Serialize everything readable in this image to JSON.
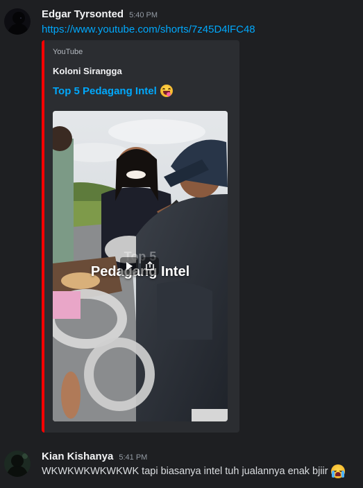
{
  "colors": {
    "background": "#1e1f22",
    "embed_background": "#2b2d31",
    "embed_border": "#ff0000",
    "link": "#00a8fc",
    "username": "#f2f3f5",
    "timestamp": "#949ba4"
  },
  "messages": [
    {
      "author": "Edgar Tyrsonted",
      "time": "5:40 PM",
      "link": "https://www.youtube.com/shorts/7z45D4lFC48",
      "embed": {
        "provider": "YouTube",
        "author": "Koloni Sirangga",
        "title": "Top 5 Pedagang Intel",
        "title_emoji": "laughing-tongue-emoji",
        "thumbnail_overlay_line1": "Top 5",
        "thumbnail_overlay_line2": "Pedagang Intel"
      }
    },
    {
      "author": "Kian Kishanya",
      "time": "5:41 PM",
      "text": "WKWKWKWKWKWK tapi biasanya intel tuh jualannya enak bjiir",
      "emoji": "loudly-crying-emoji"
    }
  ]
}
